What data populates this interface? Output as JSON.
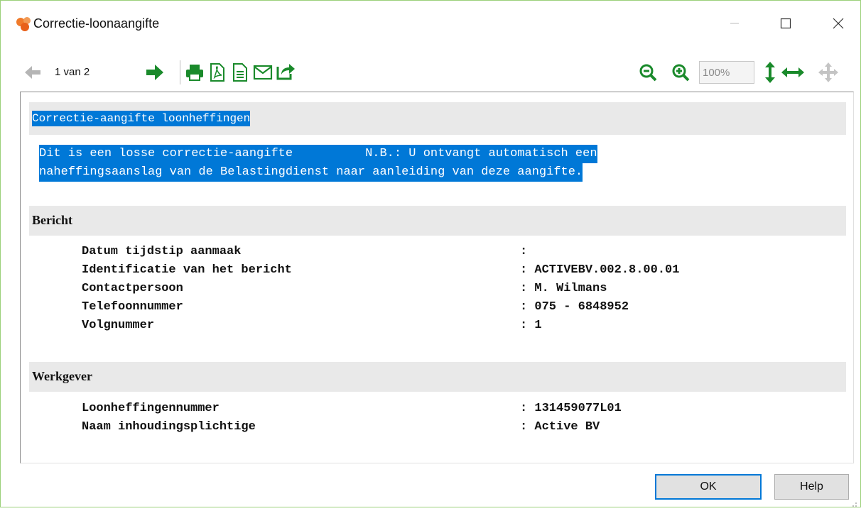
{
  "window": {
    "title": "Correctie-loonaangifte"
  },
  "toolbar": {
    "page_indicator": "1 van 2",
    "zoom_value": "100%",
    "icons": [
      "back-arrow-icon",
      "forward-arrow-icon",
      "print-icon",
      "pdf-icon",
      "document-icon",
      "mail-icon",
      "share-icon",
      "zoom-out-icon",
      "zoom-in-icon",
      "fit-height-icon",
      "fit-width-icon",
      "pan-icon"
    ]
  },
  "report": {
    "title": "Correctie-aangifte loonheffingen",
    "notice_line1": "Dit is een losse correctie-aangifte          N.B.: U ontvangt automatisch een",
    "notice_line2": "naheffingsaanslag van de Belastingdienst naar aanleiding van deze aangifte.",
    "sections": [
      {
        "title": "Bericht",
        "rows": [
          {
            "label": "Datum tijdstip aanmaak",
            "value": ":"
          },
          {
            "label": "Identificatie van het bericht",
            "value": ": ACTIVEBV.002.8.00.01"
          },
          {
            "label": "Contactpersoon",
            "value": ": M. Wilmans"
          },
          {
            "label": "Telefoonnummer",
            "value": ": 075 - 6848952"
          },
          {
            "label": "Volgnummer",
            "value": ": 1"
          }
        ]
      },
      {
        "title": "Werkgever",
        "rows": [
          {
            "label": "Loonheffingennummer",
            "value": ": 131459077L01"
          },
          {
            "label": "Naam inhoudingsplichtige",
            "value": ": Active BV"
          }
        ]
      }
    ]
  },
  "buttons": {
    "ok": "OK",
    "help": "Help"
  },
  "colors": {
    "selection": "#0078d7",
    "section_bar": "#e9e9e9",
    "toolbar_icon_active": "#1a8a2b",
    "toolbar_icon_disabled": "#9a9a9a",
    "app_icon": "#f07a2a"
  }
}
